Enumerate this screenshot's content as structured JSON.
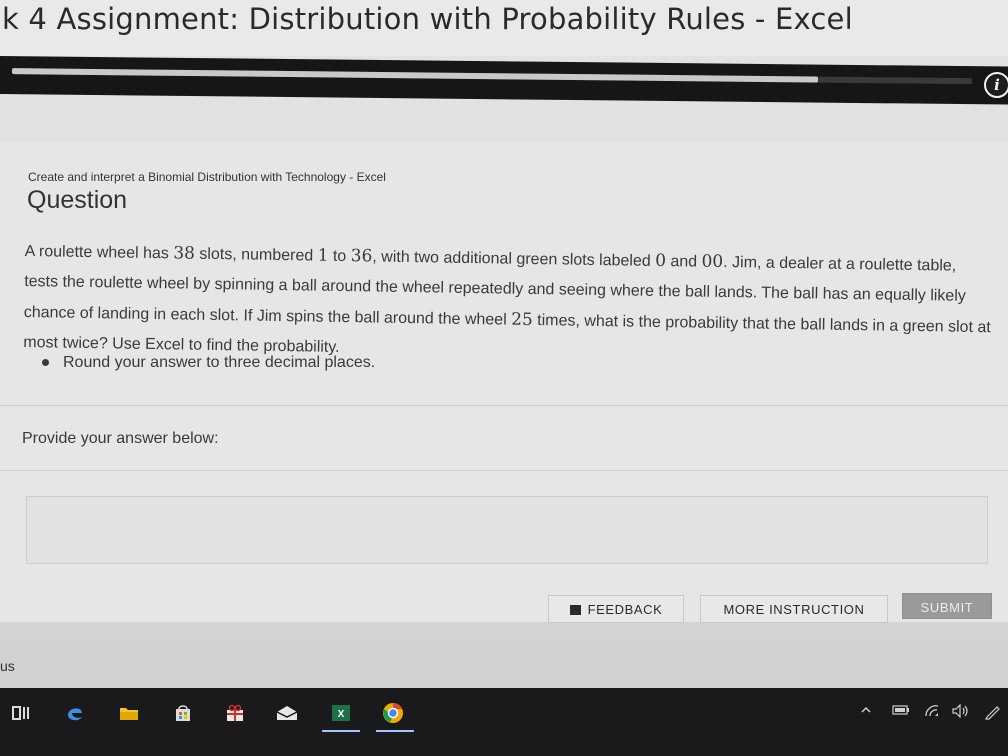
{
  "window": {
    "title": "k 4 Assignment: Distribution with Probability Rules - Excel"
  },
  "progress": {
    "fraction": 0.84
  },
  "question": {
    "subtitle": "Create and interpret a Binomial Distribution with Technology - Excel",
    "heading": "Question",
    "body_parts": [
      "A roulette wheel has ",
      "38",
      " slots, numbered ",
      "1",
      " to ",
      "36",
      ", with two additional green slots labeled ",
      "0",
      " and ",
      "00",
      ". Jim, a dealer at a roulette table, tests the roulette wheel by spinning a ball around the wheel repeatedly and seeing where the ball lands. The ball has an equally likely chance of landing in each slot. If Jim spins the ball around the wheel ",
      "25",
      " times, what is the probability that the ball lands in a green slot at most twice? Use Excel to find the probability."
    ],
    "bullet": "Round your answer to three decimal places."
  },
  "answer": {
    "label": "Provide your answer below:",
    "value": ""
  },
  "buttons": {
    "feedback": "FEEDBACK",
    "more_instruction": "MORE INSTRUCTION",
    "submit": "SUBMIT"
  },
  "status": {
    "label": "us"
  },
  "taskbar": {
    "icons": [
      "task-view-icon",
      "edge-browser-icon",
      "file-explorer-icon",
      "store-icon",
      "gift-icon",
      "mail-icon",
      "excel-icon",
      "chrome-icon"
    ],
    "tray": [
      "chevron-up-icon",
      "battery-icon",
      "wifi-icon",
      "volume-icon",
      "pen-icon"
    ]
  },
  "colors": {
    "band": "#161616",
    "submit_bg": "#9a9a98",
    "edge_blue": "#3b8ee0",
    "excel_green": "#1e7145",
    "chrome_orange": "#f2a900"
  }
}
